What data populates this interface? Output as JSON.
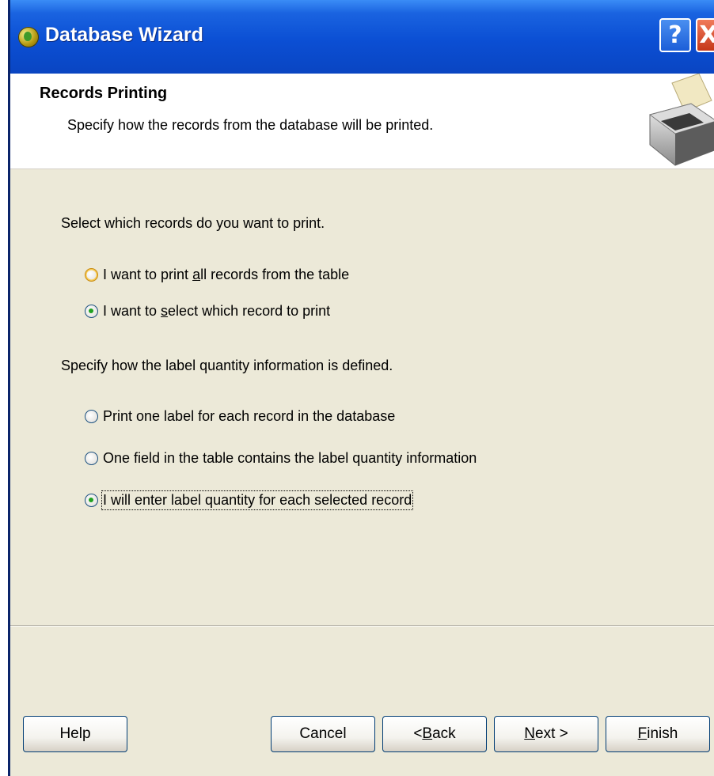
{
  "window": {
    "title": "Database Wizard",
    "help_glyph": "?",
    "close_glyph": "X"
  },
  "header": {
    "title": "Records Printing",
    "subtitle": "Specify how the records from the database will be printed."
  },
  "records": {
    "label": "Select which records do you want to print.",
    "options": [
      {
        "pre": "I want to print ",
        "key": "a",
        "post": "ll records from the table",
        "checked": false
      },
      {
        "pre": "I want to ",
        "key": "s",
        "post": "elect which record to print",
        "checked": true
      }
    ]
  },
  "quantity": {
    "label": "Specify how the label quantity information is defined.",
    "options": [
      {
        "text": "Print one label for each record in the database",
        "checked": false
      },
      {
        "text": "One field in the table contains the label quantity information",
        "checked": false
      },
      {
        "text": "I will enter label quantity for each selected record",
        "checked": true
      }
    ]
  },
  "buttons": {
    "help": "Help",
    "cancel": "Cancel",
    "back_pre": "< ",
    "back_key": "B",
    "back_post": "ack",
    "next_key": "N",
    "next_post": "ext >",
    "finish_key": "F",
    "finish_post": "inish"
  },
  "icons": {
    "app": "app-icon",
    "printer": "printer-icon"
  },
  "colors": {
    "titlebar": "#0b4fd4",
    "dialog_bg": "#ece9d8",
    "radio_checked": "#21a121"
  }
}
